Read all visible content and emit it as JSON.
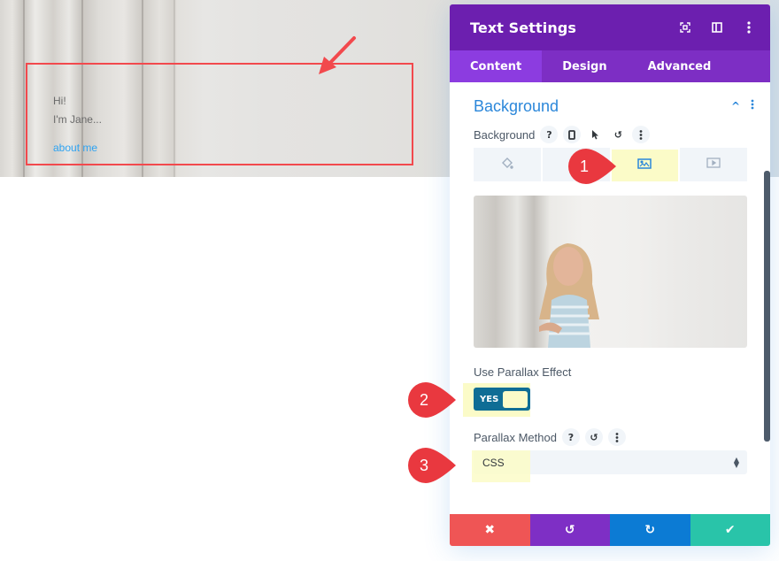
{
  "hero": {
    "line1": "Hi!",
    "line2": "I'm Jane...",
    "link": "about me"
  },
  "modal": {
    "title": "Text Settings",
    "header_icons": [
      "expand-icon",
      "sidebar-toggle-icon",
      "more-vertical-icon"
    ],
    "tabs": [
      {
        "label": "Content",
        "active": true
      },
      {
        "label": "Design",
        "active": false
      },
      {
        "label": "Advanced",
        "active": false
      }
    ],
    "section": {
      "title": "Background",
      "expanded": true
    },
    "background_field": {
      "label": "Background",
      "tools": [
        "help-icon",
        "responsive-phone-icon",
        "hover-cursor-icon",
        "reset-icon",
        "more-vertical-icon"
      ],
      "type_tabs": [
        {
          "name": "color",
          "icon": "paint-bucket-icon",
          "active": false
        },
        {
          "name": "gradient",
          "icon": "gradient-icon",
          "active": false
        },
        {
          "name": "image",
          "icon": "image-icon",
          "active": true
        },
        {
          "name": "video",
          "icon": "video-icon",
          "active": false
        }
      ]
    },
    "parallax": {
      "label": "Use Parallax Effect",
      "toggle_value": "YES",
      "enabled": true
    },
    "parallax_method": {
      "label": "Parallax Method",
      "tools": [
        "help-icon",
        "reset-icon",
        "more-vertical-icon"
      ],
      "value": "CSS"
    },
    "footer": [
      {
        "name": "discard",
        "icon": "✖",
        "color": "#ef5555"
      },
      {
        "name": "undo",
        "icon": "↺",
        "color": "#7e2fc5"
      },
      {
        "name": "redo",
        "icon": "↻",
        "color": "#0c7bd4"
      },
      {
        "name": "save",
        "icon": "✔",
        "color": "#29c4a9"
      }
    ]
  },
  "callouts": [
    "1",
    "2",
    "3"
  ],
  "colors": {
    "header": "#6c1faf",
    "tabs": "#7d2ec4",
    "active_tab": "#8c3ce0",
    "accent_blue": "#2b87da",
    "toggle": "#0f6d95",
    "callout": "#e9383f",
    "highlight": "#fbfbc8",
    "annotation_red": "#f2494d"
  }
}
